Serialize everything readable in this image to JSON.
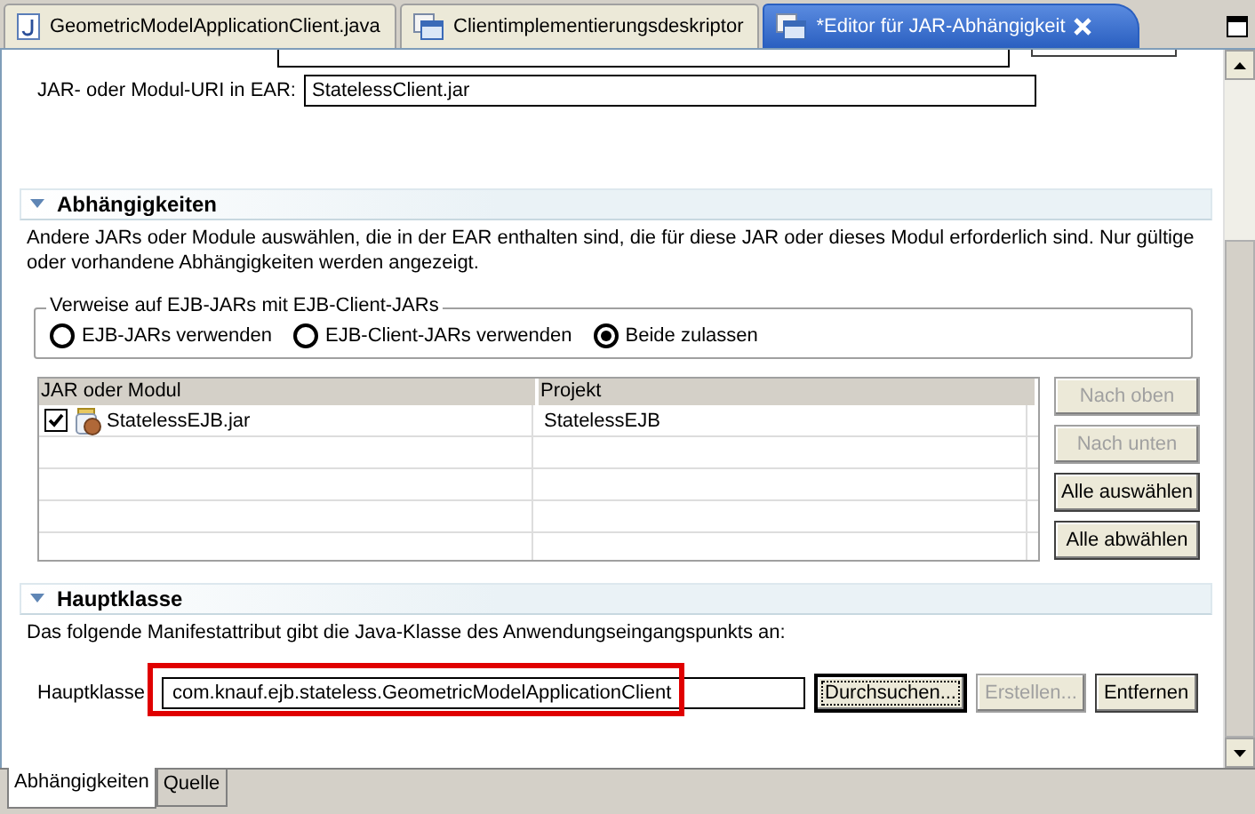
{
  "tabs": [
    {
      "label": "GeometricModelApplicationClient.java",
      "kind": "java",
      "selected": false
    },
    {
      "label": "Clientimplementierungsdeskriptor",
      "kind": "descriptor",
      "selected": false
    },
    {
      "label": "*Editor für JAR-Abhängigkeit",
      "kind": "descriptor",
      "selected": true
    }
  ],
  "jar_uri": {
    "label": "JAR- oder Modul-URI in EAR:",
    "value": "StatelessClient.jar"
  },
  "dependencies": {
    "title": "Abhängigkeiten",
    "expanded": true,
    "description": "Andere JARs oder Module auswählen, die in der EAR enthalten sind, die für diese JAR oder dieses Modul erforderlich sind.  Nur gültige oder vorhandene Abhängigkeiten werden angezeigt.",
    "group": {
      "title": "Verweise auf EJB-JARs mit EJB-Client-JARs",
      "options": [
        {
          "label": "EJB-JARs verwenden",
          "selected": false
        },
        {
          "label": "EJB-Client-JARs verwenden",
          "selected": false
        },
        {
          "label": "Beide zulassen",
          "selected": true
        }
      ]
    },
    "table": {
      "columns": [
        "JAR oder Modul",
        "Projekt"
      ],
      "rows": [
        {
          "checked": true,
          "name": "StatelessEJB.jar",
          "project": "StatelessEJB"
        }
      ]
    },
    "buttons": [
      {
        "label": "Nach oben",
        "disabled": true
      },
      {
        "label": "Nach unten",
        "disabled": true
      },
      {
        "label": "Alle auswählen",
        "disabled": false
      },
      {
        "label": "Alle abwählen",
        "disabled": false
      }
    ]
  },
  "main_class": {
    "title": "Hauptklasse",
    "expanded": true,
    "description": "Das folgende Manifestattribut gibt die Java-Klasse des Anwendungseingangspunkts an:",
    "label": "Hauptklasse",
    "value": "com.knauf.ejb.stateless.GeometricModelApplicationClient",
    "highlighted": true,
    "buttons": [
      {
        "label": "Durchsuchen...",
        "disabled": false,
        "focused": true
      },
      {
        "label": "Erstellen...",
        "disabled": true,
        "focused": false
      },
      {
        "label": "Entfernen",
        "disabled": false,
        "focused": false
      }
    ]
  },
  "page_tabs": [
    {
      "label": "Abhängigkeiten",
      "selected": true
    },
    {
      "label": "Quelle",
      "selected": false
    }
  ]
}
